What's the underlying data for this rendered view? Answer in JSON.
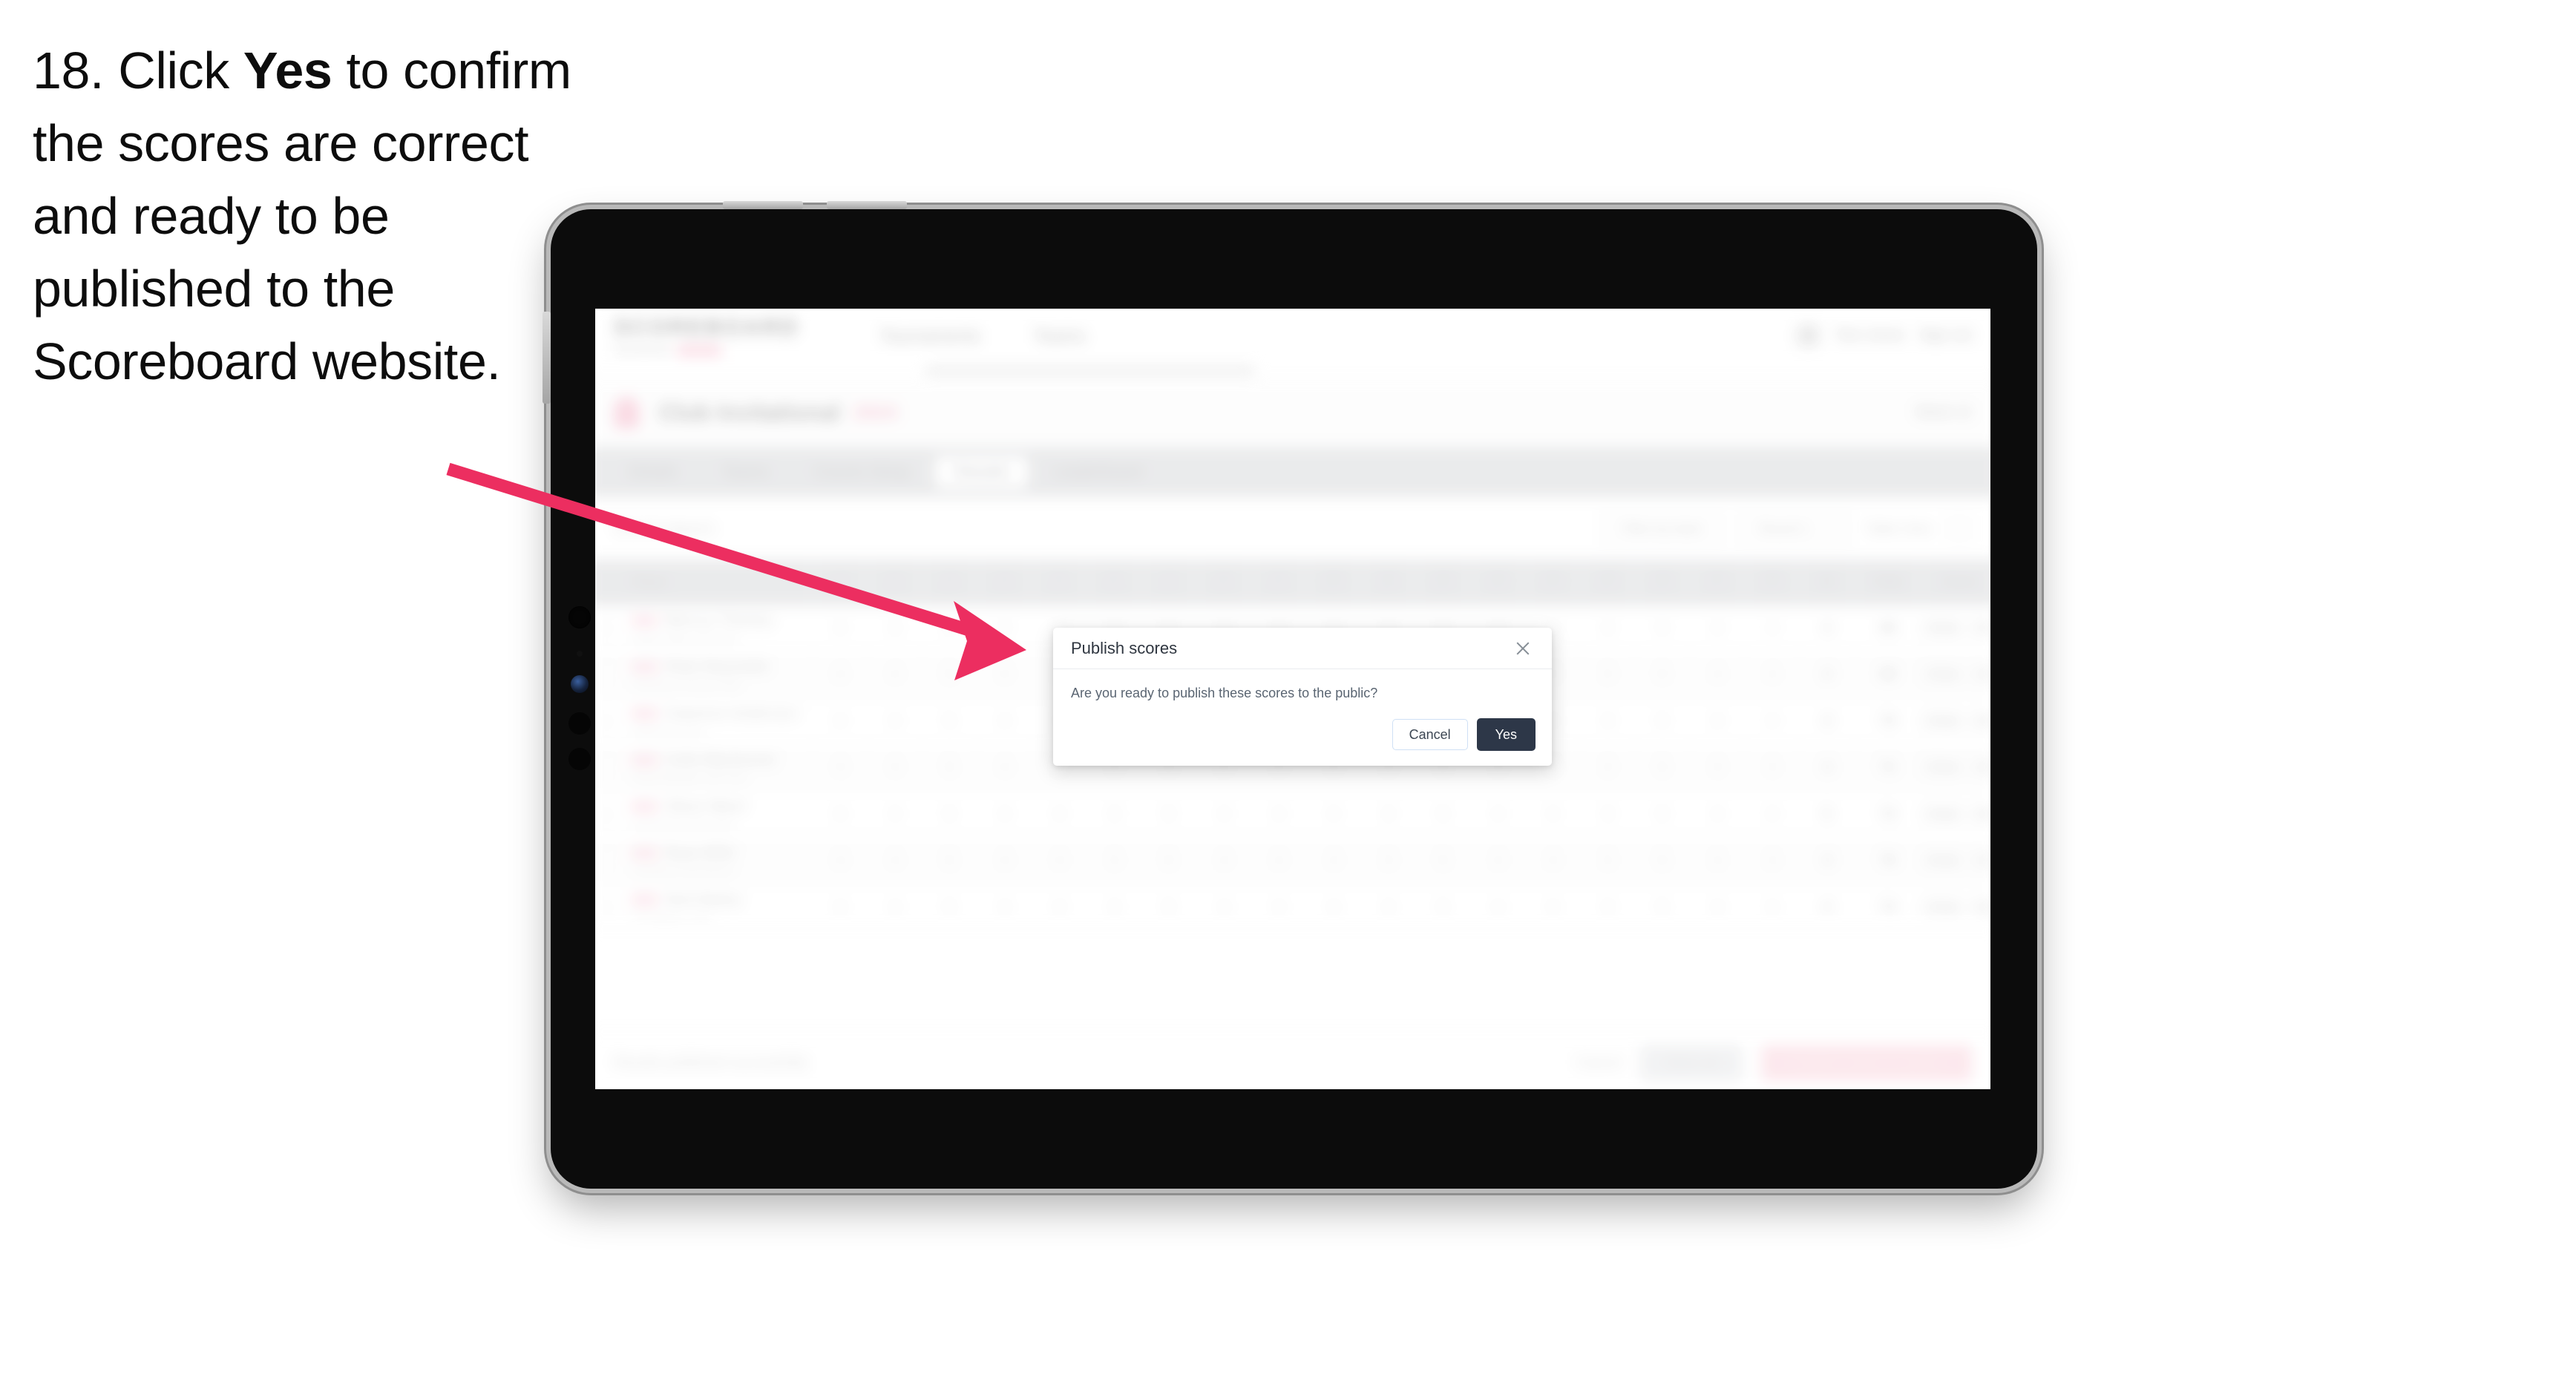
{
  "instruction": {
    "number": "18.",
    "part1": "Click ",
    "emphasis": "Yes",
    "part2": " to confirm the scores are correct and ready to be published to the Scoreboard website."
  },
  "colors": {
    "arrow": "#EC2E60",
    "modal_primary_button": "#2D3748",
    "modal_cancel_border": "#CFE0F5",
    "brand_accent": "#F06292",
    "device_frame": "#0C0C0C",
    "device_edge": "#B9B9B9"
  },
  "device": {
    "type": "tablet",
    "hardware_buttons": [
      "volume-up",
      "volume-down",
      "power"
    ]
  },
  "app": {
    "brand": {
      "logo": "SCOREBOARD",
      "subtitle": "Tournaments",
      "pill": "BETA"
    },
    "nav": [
      {
        "label": "Tournaments"
      },
      {
        "label": "Teams"
      }
    ],
    "user": {
      "name": "Tom Jones",
      "signout": "Sign out"
    },
    "event": {
      "name": "Club Invitational",
      "tag": "2024",
      "right_label": "Week 12"
    },
    "tabs": [
      {
        "label": "Details",
        "active": false
      },
      {
        "label": "Teams",
        "active": false
      },
      {
        "label": "Course Setup",
        "active": false
      },
      {
        "label": "Results",
        "active": true
      },
      {
        "label": "Leaderboard",
        "active": false
      }
    ],
    "filters": {
      "search_placeholder": "Search players",
      "controls": [
        {
          "label": "Filter by team"
        },
        {
          "label": "Round 1"
        }
      ],
      "plain_label": "Table View",
      "icon": "grid-icon"
    },
    "table": {
      "headers": {
        "player": "Player",
        "holes": [
          {
            "num": "1",
            "par": "Par 4"
          },
          {
            "num": "2",
            "par": "Par 3"
          },
          {
            "num": "3",
            "par": "Par 5"
          },
          {
            "num": "4",
            "par": "Par 4"
          },
          {
            "num": "5",
            "par": "Par 4"
          },
          {
            "num": "6",
            "par": "Par 3"
          },
          {
            "num": "7",
            "par": "Par 5"
          },
          {
            "num": "8",
            "par": "Par 4"
          },
          {
            "num": "9",
            "par": "Par 4"
          },
          {
            "num": "10",
            "par": "Par 4"
          },
          {
            "num": "11",
            "par": "Par 3"
          },
          {
            "num": "12",
            "par": "Par 5"
          },
          {
            "num": "13",
            "par": "Par 4"
          },
          {
            "num": "14",
            "par": "Par 4"
          },
          {
            "num": "15",
            "par": "Par 3"
          },
          {
            "num": "16",
            "par": "Par 5"
          },
          {
            "num": "17",
            "par": "Par 4"
          },
          {
            "num": "18",
            "par": "Par 4"
          }
        ],
        "out": "R",
        "total": "Total",
        "score": "Score"
      },
      "rows": [
        {
          "name": "Marcus Thomas",
          "sub": "Eagle Ridge Golf Club",
          "scores": [
            "4",
            "3",
            "5",
            "4",
            "4",
            "3",
            "5",
            "4",
            "4",
            "4",
            "3",
            "5",
            "4",
            "4",
            "3",
            "5",
            "4",
            "4"
          ],
          "out": "4",
          "total": "68",
          "score": "-4",
          "badges": [
            "Final",
            "72"
          ]
        },
        {
          "name": "Peter Reynolds",
          "sub": "Pinehurst Country Club",
          "scores": [
            "4",
            "4",
            "5",
            "4",
            "4",
            "3",
            "5",
            "4",
            "4",
            "4",
            "3",
            "5",
            "4",
            "4",
            "3",
            "5",
            "4",
            "4"
          ],
          "out": "4",
          "total": "69",
          "score": "-3",
          "badges": [
            "Final",
            "73"
          ]
        },
        {
          "name": "Cameron Anderson",
          "sub": "Oakmont Links",
          "scores": [
            "4",
            "4",
            "5",
            "4",
            "4",
            "3",
            "5",
            "4",
            "4",
            "4",
            "3",
            "5",
            "4",
            "4",
            "3",
            "5",
            "4",
            "4"
          ],
          "out": "4",
          "total": "70",
          "score": "-2",
          "badges": [
            "Final",
            "74"
          ]
        },
        {
          "name": "Colin Mackenzie",
          "sub": "Royal Birkdale Golf Club",
          "scores": [
            "4",
            "4",
            "5",
            "4",
            "4",
            "3",
            "5",
            "4",
            "4",
            "4",
            "3",
            "5",
            "4",
            "4",
            "3",
            "5",
            "4",
            "4"
          ],
          "out": "4",
          "total": "71",
          "score": "-1",
          "badges": [
            "Final",
            "75"
          ]
        },
        {
          "name": "Oliver Ward",
          "sub": "Carnoustie Golf Links",
          "scores": [
            "4",
            "4",
            "5",
            "4",
            "4",
            "3",
            "5",
            "4",
            "4",
            "4",
            "3",
            "5",
            "4",
            "4",
            "3",
            "5",
            "4",
            "4"
          ],
          "out": "5",
          "total": "72",
          "score": "E",
          "badges": [
            "Final",
            "76"
          ]
        },
        {
          "name": "Ryan Mills",
          "sub": "Turnberry Golf Resort",
          "scores": [
            "4",
            "4",
            "5",
            "4",
            "4",
            "3",
            "5",
            "4",
            "4",
            "4",
            "3",
            "5",
            "4",
            "4",
            "3",
            "5",
            "4",
            "4"
          ],
          "out": "4",
          "total": "73",
          "score": "+1",
          "badges": [
            "Final",
            "77"
          ]
        },
        {
          "name": "Nick Bailey",
          "sub": "St Andrews Links",
          "scores": [
            "4",
            "4",
            "5",
            "4",
            "4",
            "3",
            "5",
            "4",
            "4",
            "4",
            "3",
            "5",
            "4",
            "4",
            "3",
            "5",
            "4",
            "4"
          ],
          "out": "4",
          "total": "74",
          "score": "+2",
          "badges": [
            "Final",
            "78"
          ]
        }
      ]
    },
    "footer": {
      "note": "Results published successfully",
      "cancel_label": "Cancel",
      "save_label": "Save all",
      "publish_label": "Publish scores to public"
    }
  },
  "modal": {
    "title": "Publish scores",
    "message": "Are you ready to publish these scores to the public?",
    "cancel_label": "Cancel",
    "confirm_label": "Yes",
    "close_icon": "close-icon"
  }
}
